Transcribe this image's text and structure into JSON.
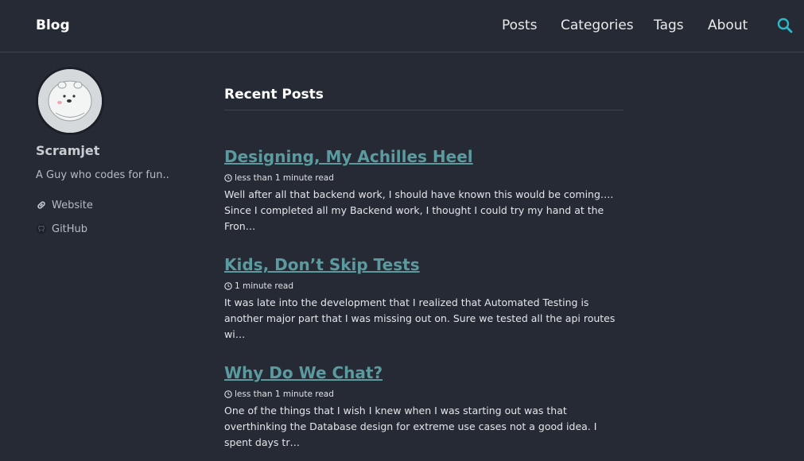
{
  "header": {
    "site_title": "Blog",
    "nav": [
      "Posts",
      "Categories",
      "Tags",
      "About"
    ],
    "search_icon": "search-icon",
    "accent_color": "#2eb8c7"
  },
  "sidebar": {
    "author_name": "Scramjet",
    "bio": "A Guy who codes for fun..",
    "links": [
      {
        "label": "Website",
        "icon": "link-icon"
      },
      {
        "label": "GitHub",
        "icon": "github-icon"
      }
    ]
  },
  "main": {
    "heading": "Recent Posts",
    "posts": [
      {
        "title": "Designing, My Achilles Heel",
        "read_time": "less than 1 minute read",
        "excerpt": "Well after all that backend work, I should have known this would be coming…. Since I completed all my Backend work, I thought I could try my hand at the Fron…"
      },
      {
        "title": "Kids, Don’t Skip Tests",
        "read_time": "1 minute read",
        "excerpt": "It was late into the development that I realized that Automated Testing is another major part that I was missing out on. Sure we tested all the api routes wi…"
      },
      {
        "title": "Why Do We Chat?",
        "read_time": "less than 1 minute read",
        "excerpt": "One of the things that I wish I knew when I was starting out was that overthinking the Database design for extreme use cases not a good idea. I spent days tr…"
      }
    ]
  },
  "colors": {
    "background": "#252a34",
    "link": "#5b9a9e",
    "text": "#eaeaea"
  }
}
